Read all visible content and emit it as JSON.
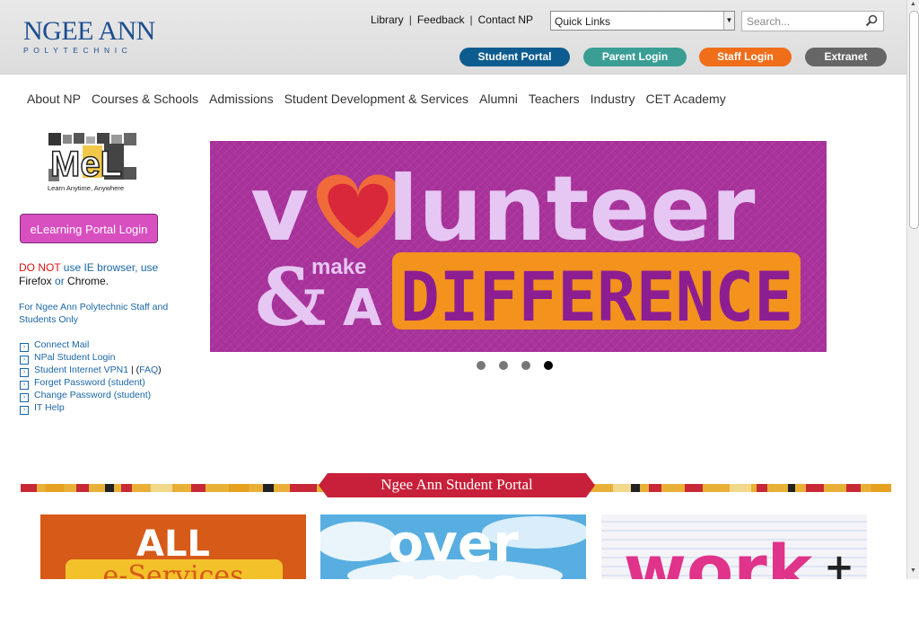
{
  "logo": {
    "main": "NGEE ANN",
    "sub": "POLYTECHNIC"
  },
  "toplinks": [
    "Library",
    "Feedback",
    "Contact NP"
  ],
  "quick_links": {
    "value": "Quick Links"
  },
  "search": {
    "placeholder": "Search..."
  },
  "buttons": [
    {
      "label": "Student Portal",
      "color": "#0d5c8f"
    },
    {
      "label": "Parent Login",
      "color": "#3a9e95"
    },
    {
      "label": "Staff Login",
      "color": "#f06d1a"
    },
    {
      "label": "Extranet",
      "color": "#666666"
    }
  ],
  "nav": [
    "About NP",
    "Courses & Schools",
    "Admissions",
    "Student Development & Services",
    "Alumni",
    "Teachers",
    "Industry",
    "CET Academy"
  ],
  "mel": {
    "logo_text": "MeL",
    "caption": "Learn Anytime, Anywhere"
  },
  "elearning_button": "eLearning Portal Login",
  "warning": {
    "red": "DO NOT",
    "t1": " use IE browser, use ",
    "firefox": "Firefox",
    "or": " or ",
    "chrome": "Chrome",
    "end": "."
  },
  "staff_note": "For Ngee Ann Polytechnic Staff and Students Only",
  "links": [
    "Connect Mail",
    "NPal Student Login",
    "Student Internet VPN1",
    "Forget Password (student)",
    "Change Password (student)",
    "IT Help"
  ],
  "vpn_faq": "FAQ",
  "banner": {
    "word1": "v",
    "word2": "lunteer",
    "amp": "&",
    "make": "make",
    "a": "A",
    "difference": "DIFFERENCE",
    "bg_color": "#a8339b"
  },
  "carousel": {
    "count": 4,
    "active": 4
  },
  "portal_title": "Ngee Ann Student Portal",
  "tiles": [
    {
      "text1": "ALL",
      "text2": "e-Services"
    },
    {
      "text1": "over",
      "text2": "seas"
    },
    {
      "text1": "work",
      "text2": "+"
    }
  ]
}
